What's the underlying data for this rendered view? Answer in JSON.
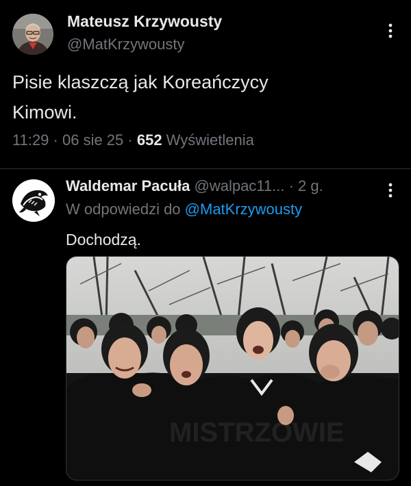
{
  "main_tweet": {
    "author_name": "Mateusz Krzywousty",
    "author_handle": "@MatKrzywousty",
    "text_line1": "Pisie klaszczą jak Koreańczycy",
    "text_line2": "Kimowi.",
    "time": "11:29",
    "sep1": " · ",
    "date": "06 sie 25",
    "sep2": " · ",
    "views_count": "652",
    "views_label": " Wyświetlenia",
    "more_icon": "more-vertical-icon"
  },
  "reply": {
    "author_name": "Waldemar Pacuła",
    "author_handle": " @walpac11...",
    "sep": " · ",
    "age": "2 g.",
    "replying_prefix": "W odpowiedzi do ",
    "replying_mention": "@MatKrzywousty",
    "text": "Dochodzą.",
    "media_icon": "photo-crying-crowd",
    "more_icon": "more-vertical-icon"
  },
  "colors": {
    "background": "#000000",
    "text_primary": "#e7e9ea",
    "text_secondary": "#71767b",
    "accent": "#1d9bf0",
    "divider": "#2f3336"
  }
}
